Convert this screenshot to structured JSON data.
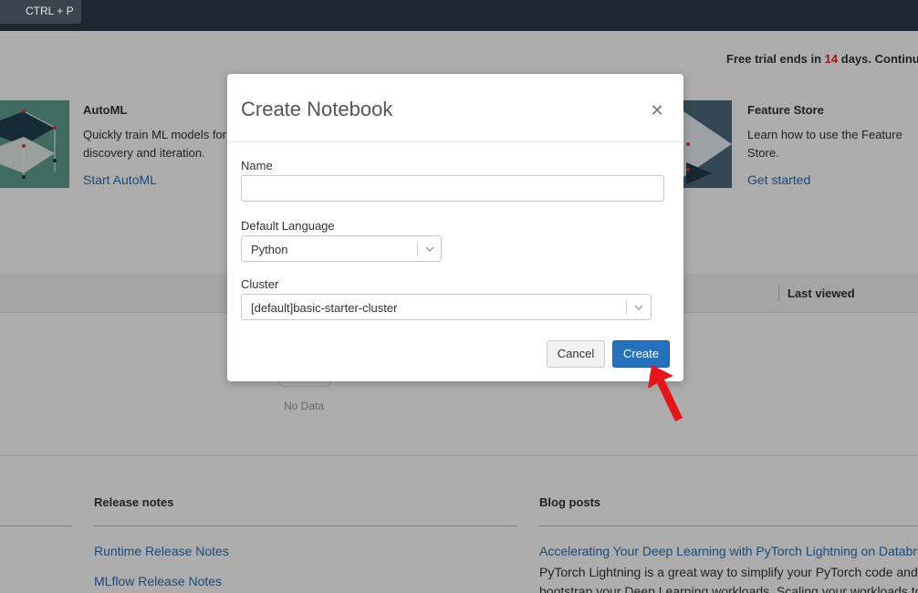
{
  "topbar": {
    "shortcut": "CTRL + P"
  },
  "trial": {
    "prefix": "Free trial ends in",
    "days": "14",
    "suffix": "days. Continue"
  },
  "cards": [
    {
      "title": "AutoML",
      "desc_line1": "Quickly train ML models for",
      "desc_line2": "discovery and iteration.",
      "link": "Start AutoML",
      "icon": "automl-illustration"
    },
    {
      "title": "Feature Store",
      "desc_line1": "Learn how to use the Feature",
      "desc_line2": "Store.",
      "link": "Get started",
      "icon": "feature-store-illustration"
    }
  ],
  "table": {
    "last_viewed": "Last viewed",
    "empty": "No Data"
  },
  "footer": {
    "release_title": "Release notes",
    "release_links": [
      "Runtime Release Notes",
      "MLflow Release Notes"
    ],
    "blog_title": "Blog posts",
    "blog_link": "Accelerating Your Deep Learning with PyTorch Lightning on Databri",
    "blog_text1": "PyTorch Lightning is a great way to simplify your PyTorch code and",
    "blog_text2": "bootstrap your Deep Learning workloads. Scaling your workloads to"
  },
  "modal": {
    "title": "Create Notebook",
    "close_icon": "close-icon",
    "name_label": "Name",
    "name_value": "",
    "language_label": "Default Language",
    "language_value": "Python",
    "cluster_label": "Cluster",
    "cluster_value": "[default]basic-starter-cluster",
    "cancel_label": "Cancel",
    "create_label": "Create"
  },
  "colors": {
    "accent": "#2671bd",
    "link": "#2a6fb2",
    "trial_days": "#e0261f",
    "pointer_arrow": "#e8141b"
  }
}
